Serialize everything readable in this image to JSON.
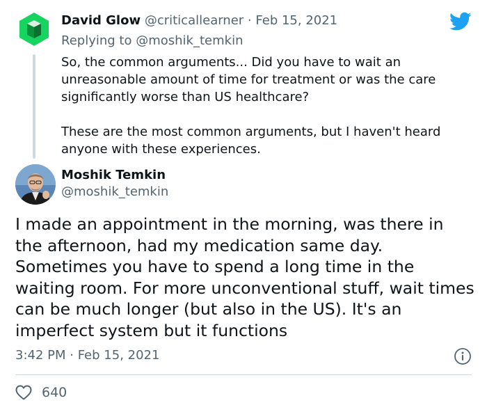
{
  "colors": {
    "twitter_blue": "#1da1f2",
    "text_primary": "#0f1419",
    "text_secondary": "#536471",
    "divider": "#cfd9de",
    "parent_avatar_green": "#17d35f"
  },
  "icons": {
    "brand": "twitter-bird-icon",
    "info": "info-icon",
    "like": "heart-outline-icon"
  },
  "parent_tweet": {
    "author_name": "David Glow",
    "author_handle": "@criticallearner",
    "separator": "·",
    "date": "Feb 15, 2021",
    "replying_prefix": "Replying to",
    "replying_to": "@moshik_temkin",
    "paragraphs": [
      "So, the common arguments... Did you have to wait an unreasonable amount of time for treatment or was the care significantly worse than US healthcare?",
      "These are the most common arguments, but I haven't heard anyone with these experiences."
    ]
  },
  "main_tweet": {
    "author_name": "Moshik Temkin",
    "author_handle": "@moshik_temkin",
    "text": "I made an appointment in the morning, was there in the afternoon, had my medication same day. Sometimes you have to spend a long time in the waiting room. For more unconventional stuff, wait times can be much longer (but also in the US). It's an imperfect system but it functions",
    "timestamp": "3:42 PM · Feb 15, 2021",
    "like_count": "640"
  }
}
